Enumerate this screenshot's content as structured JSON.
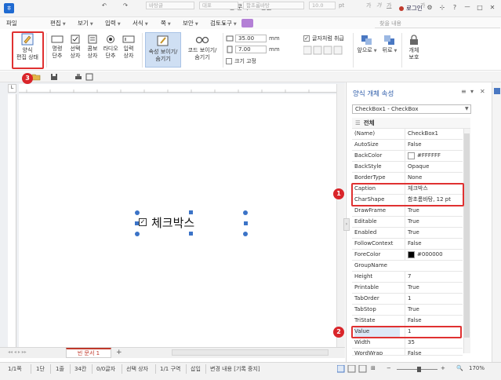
{
  "window": {
    "title": "빈 문서 1 - 한글",
    "login": "로그인",
    "controls": [
      "?",
      "ㅡ",
      "□",
      "✕"
    ]
  },
  "menu": {
    "items": [
      "파일",
      "편집",
      "보기",
      "입력",
      "서식",
      "쪽",
      "보안",
      "검토",
      "도구"
    ],
    "search_placeholder": "찾을 내용"
  },
  "ribbon": {
    "form_edit_mode": "양식\n편집 상태",
    "controls": [
      "명령\n단추",
      "선택\n상자",
      "콤보\n상자",
      "라디오\n단추",
      "입력\n상자"
    ],
    "show_hide_props": "속성 보이기/\n숨기기",
    "show_hide_code": "코드 보이기/\n숨기기",
    "width_value": "35.00",
    "height_value": "7.00",
    "unit": "mm",
    "fix_size": "크기 고정",
    "allow_wrap": "글자처럼 취급",
    "bring_front": "앞으로",
    "send_back": "뒤로",
    "object_protect": "개체\n보호"
  },
  "toolbar2": {
    "style": "바탕글",
    "lang": "대표",
    "font": "함초롬바탕",
    "size": "10.0",
    "size_unit": "pt"
  },
  "document": {
    "checkbox_caption": "체크박스",
    "checkbox_checked": "✓",
    "tab_name": "빈 문서 1",
    "tab_add": "+"
  },
  "panel": {
    "title": "양식 개체 속성",
    "object_selector": "CheckBox1 - CheckBox",
    "category": "전체",
    "props": [
      {
        "name": "(Name)",
        "value": "CheckBox1"
      },
      {
        "name": "AutoSize",
        "value": "False"
      },
      {
        "name": "BackColor",
        "value": "#FFFFFF",
        "swatch": "#FFFFFF"
      },
      {
        "name": "BackStyle",
        "value": "Opaque"
      },
      {
        "name": "BorderType",
        "value": "None"
      },
      {
        "name": "Caption",
        "value": "체크박스"
      },
      {
        "name": "CharShape",
        "value": "함초롬바탕, 12 pt"
      },
      {
        "name": "DrawFrame",
        "value": "True"
      },
      {
        "name": "Editable",
        "value": "True"
      },
      {
        "name": "Enabled",
        "value": "True"
      },
      {
        "name": "FollowContext",
        "value": "False"
      },
      {
        "name": "ForeColor",
        "value": "#000000",
        "swatch": "#000000"
      },
      {
        "name": "GroupName",
        "value": ""
      },
      {
        "name": "Height",
        "value": "7"
      },
      {
        "name": "Printable",
        "value": "True"
      },
      {
        "name": "TabOrder",
        "value": "1"
      },
      {
        "name": "TabStop",
        "value": "True"
      },
      {
        "name": "TriState",
        "value": "False"
      },
      {
        "name": "Value",
        "value": "1"
      },
      {
        "name": "Width",
        "value": "35"
      },
      {
        "name": "WordWrap",
        "value": "False"
      }
    ]
  },
  "badges": [
    "1",
    "2",
    "3"
  ],
  "status": {
    "page": "1/1쪽",
    "section": "1단",
    "line": "1줄",
    "column": "34칸",
    "chars": "0/0글자",
    "selection": "선택 상자",
    "zone": "1/1 구역",
    "insert": "삽입",
    "track_changes": "변경 내용 [기록 중지]",
    "zoom": "170%"
  },
  "colors": {
    "accent": "#2b5aa8",
    "highlight": "#e03131",
    "handle": "#3b73c7"
  }
}
